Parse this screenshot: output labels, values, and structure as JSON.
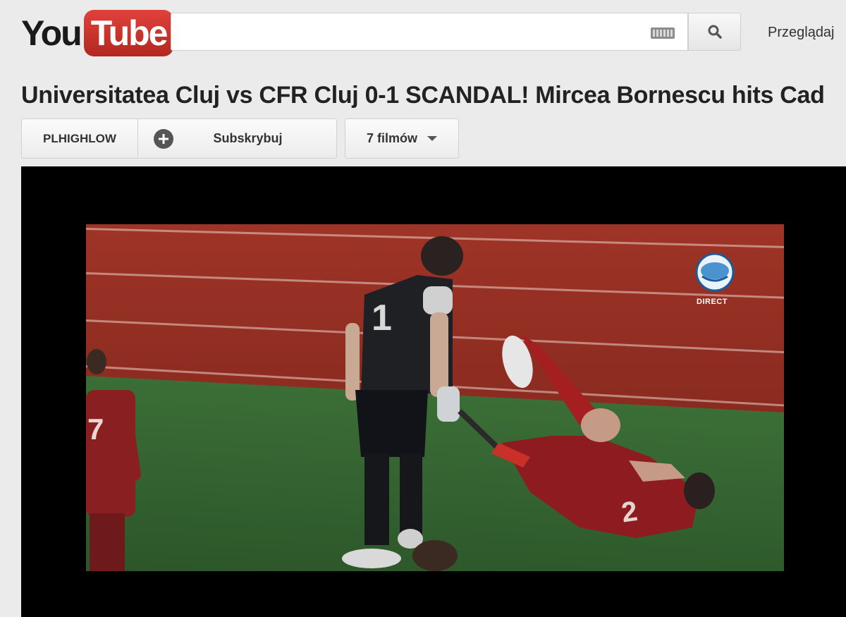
{
  "header": {
    "logo_you": "You",
    "logo_tube": "Tube",
    "search": {
      "value": "",
      "placeholder": ""
    },
    "browse_label": "Przeglądaj"
  },
  "video": {
    "title": "Universitatea Cluj vs CFR Cluj 0-1 SCANDAL! Mircea Bornescu hits Cad",
    "channel_name": "PLHIGHLOW",
    "subscribe_label": "Subskrybuj",
    "videos_count_label": "7 filmów",
    "overlay_badge_text": "DIRECT",
    "jersey_numbers": [
      "1",
      "2",
      "7"
    ]
  },
  "colors": {
    "brand_red": "#c4302b",
    "background": "#ebebeb",
    "player_bg": "#000000"
  },
  "icons": [
    "keyboard-icon",
    "search-icon",
    "plus-icon",
    "caret-down-icon"
  ]
}
